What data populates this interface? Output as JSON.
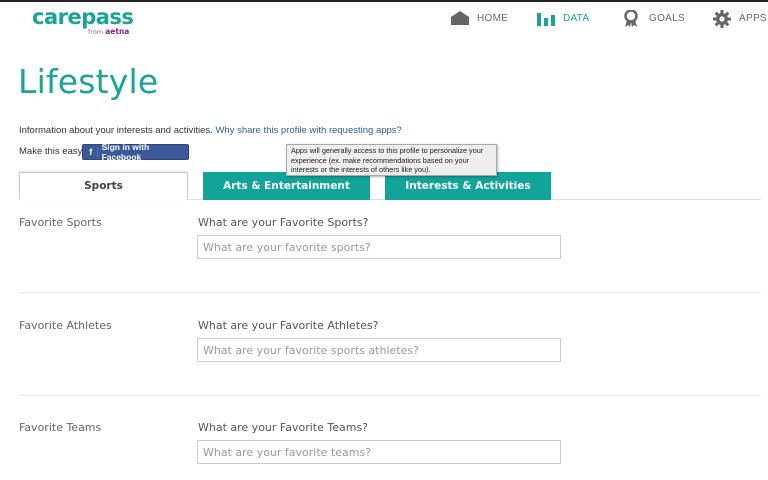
{
  "brand": {
    "name": "carepass",
    "sub_prefix": "from",
    "sub_brand": "aetna"
  },
  "nav": [
    {
      "label": "HOME",
      "icon": "home-icon",
      "active": false
    },
    {
      "label": "DATA",
      "icon": "bar-chart-icon",
      "active": true
    },
    {
      "label": "GOALS",
      "icon": "ribbon-icon",
      "active": false
    },
    {
      "label": "APPS",
      "icon": "gear-icon",
      "active": false
    }
  ],
  "page": {
    "title": "Lifestyle",
    "info_text": "Information about your interests and activities.",
    "why_link": "Why share this profile with requesting apps?",
    "easy_text": "Make this easy",
    "fb_button": "Sign in with Facebook",
    "fb_icon": "f",
    "tooltip": "Apps will generally access to this profile to personalize your experience (ex. make recommendations based on your interests or the interests of others like you)."
  },
  "tabs": [
    {
      "label": "Sports",
      "selected": true
    },
    {
      "label": "Arts & Entertainment",
      "selected": false
    },
    {
      "label": "Interests & Activities",
      "selected": false
    }
  ],
  "sections": [
    {
      "label": "Favorite Sports",
      "question": "What are your Favorite Sports?",
      "placeholder": "What are your favorite sports?",
      "value": ""
    },
    {
      "label": "Favorite Athletes",
      "question": "What are your Favorite Athletes?",
      "placeholder": "What are your favorite sports athletes?",
      "value": ""
    },
    {
      "label": "Favorite Teams",
      "question": "What are your Favorite Teams?",
      "placeholder": "What are your favorite teams?",
      "value": ""
    }
  ],
  "colors": {
    "accent": "#19a39b",
    "tab_teal": "#12a39a",
    "facebook": "#3b5998",
    "link": "#2a5f9e",
    "brand_sub": "#7a2a8c"
  }
}
